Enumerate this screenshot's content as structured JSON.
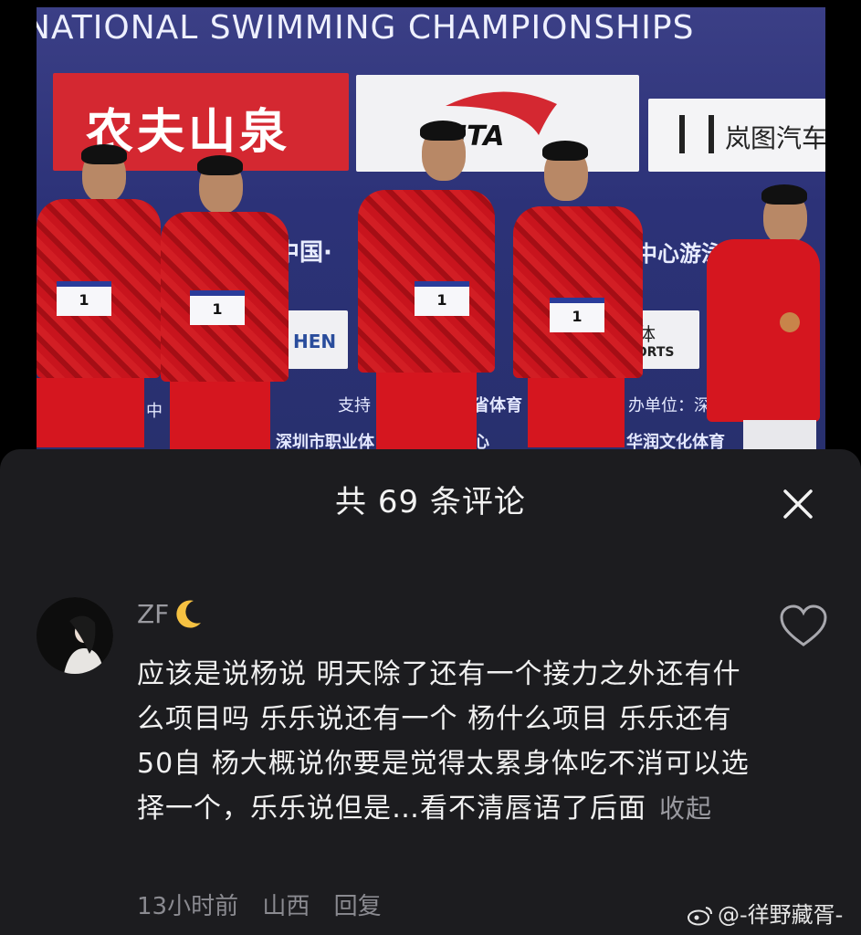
{
  "photo": {
    "banner_title": "NATIONAL SWIMMING CHAMPIONSHIPS",
    "sponsor_red": "农夫山泉",
    "sponsor_sport": "NTA",
    "sponsor_car": "岚图汽车",
    "board_mid_left": "中国·",
    "board_mid_right": "中心游泳馆",
    "board_hen": "HEN",
    "board_ti": "体",
    "board_sports": "E SPORTS",
    "support_label": "支持",
    "province_sport": "省体育",
    "organizer": "办单位：深",
    "line_bottom_left": "深圳市职业体",
    "line_bottom_mid": "心",
    "line_bottom_right": "华润文化体育",
    "zhong": "中",
    "bib_number": "1",
    "bib_left": "1",
    "bib_center": "1",
    "bib_right": "1"
  },
  "sheet": {
    "title": "共 69 条评论",
    "close_icon": "close-icon"
  },
  "comment": {
    "username": "ZF",
    "moon_icon": "crescent-moon-icon",
    "body": "应该是说杨说 明天除了还有一个接力之外还有什么项目吗 乐乐说还有一个 杨什么项目 乐乐还有50自 杨大概说你要是觉得太累身体吃不消可以选择一个，乐乐说但是…看不清唇语了后面",
    "collapse": "收起",
    "time": "13小时前",
    "location": "山西",
    "reply": "回复",
    "like_icon": "heart-outline-icon"
  },
  "watermark": {
    "text": "@-徉野藏胥-",
    "icon": "weibo-icon"
  },
  "colors": {
    "sheet_bg": "#1c1c1f",
    "secondary_text": "#9a9aa0",
    "primary_text": "#f1f1f1",
    "jacket_red": "#c8141d"
  }
}
